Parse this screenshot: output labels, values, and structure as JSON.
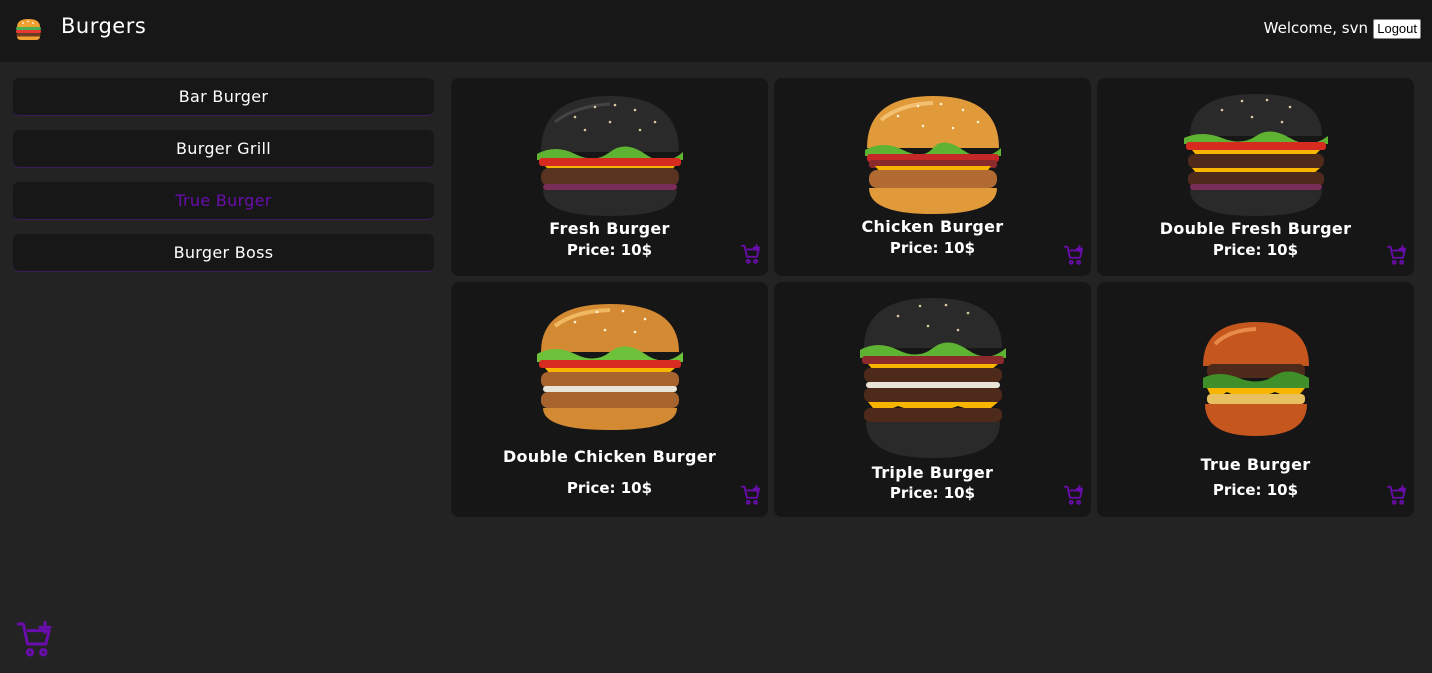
{
  "header": {
    "title": "Burgers",
    "logo_icon": "burger-icon",
    "welcome_text": "Welcome, svn",
    "logout_label": "Logout"
  },
  "sidebar": {
    "items": [
      {
        "label": "Bar Burger",
        "active": false
      },
      {
        "label": "Burger Grill",
        "active": false
      },
      {
        "label": "True Burger",
        "active": true
      },
      {
        "label": "Burger Boss",
        "active": false
      }
    ]
  },
  "products": [
    {
      "name": "Fresh Burger",
      "price": "Price: 10$",
      "bun": "black"
    },
    {
      "name": "Chicken Burger",
      "price": "Price: 10$",
      "bun": "golden"
    },
    {
      "name": "Double Fresh Burger",
      "price": "Price: 10$",
      "bun": "black"
    },
    {
      "name": "Double Chicken Burger",
      "price": "Price: 10$",
      "bun": "golden"
    },
    {
      "name": "Triple Burger",
      "price": "Price: 10$",
      "bun": "black"
    },
    {
      "name": "True Burger",
      "price": "Price: 10$",
      "bun": "orange"
    }
  ],
  "icons": {
    "add_to_cart": "cart-plus-icon",
    "floating_cart": "cart-plus-icon"
  },
  "colors": {
    "accent": "#6a0dad",
    "background": "#232323",
    "panel": "#171717"
  }
}
